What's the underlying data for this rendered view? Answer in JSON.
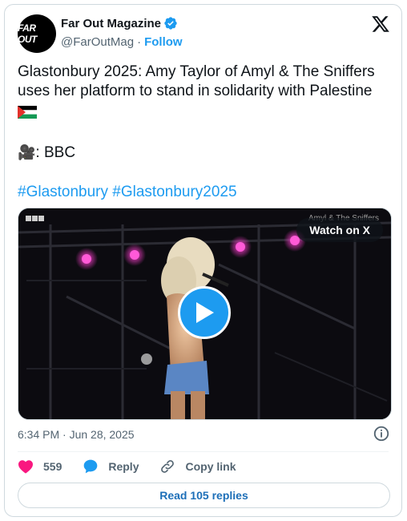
{
  "author": {
    "name": "Far Out Magazine",
    "handle": "@FarOutMag",
    "separator": "·",
    "follow_label": "Follow",
    "avatar_text": "FAR OUT"
  },
  "tweet": {
    "text_line": "Glastonbury 2025: Amy Taylor of Amyl & The Sniffers uses her platform to stand in solidarity with Palestine",
    "credit": ": BBC",
    "credit_icon": "🎥",
    "hashtags": [
      "#Glastonbury",
      "#Glastonbury2025"
    ]
  },
  "media": {
    "watch_label": "Watch on X",
    "bbc_logo": "BBC",
    "overlay_title": "Amyl & The Sniffers"
  },
  "meta": {
    "timestamp": "6:34 PM · Jun 28, 2025"
  },
  "actions": {
    "likes_count": "559",
    "reply_label": "Reply",
    "copy_link_label": "Copy link"
  },
  "read_replies_label": "Read 105 replies",
  "colors": {
    "accent": "#1d9bf0",
    "like": "#f91880",
    "reply_icon": "#1d9bf0"
  }
}
